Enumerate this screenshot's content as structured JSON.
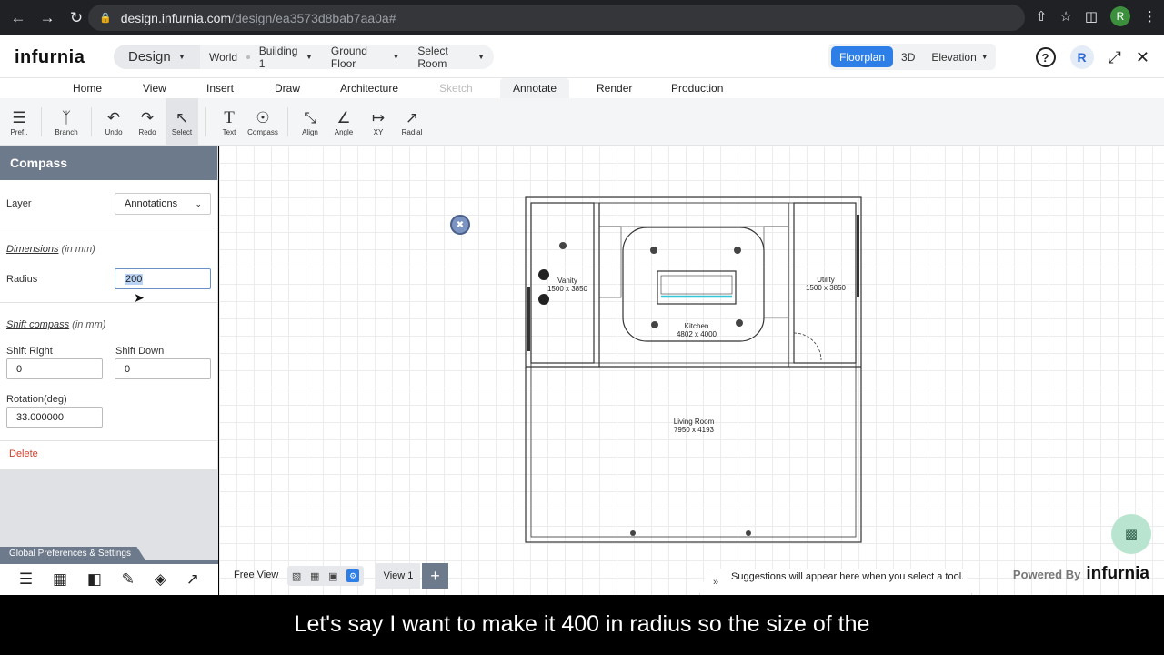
{
  "browser": {
    "url_host": "design.infurnia.com",
    "url_path": "/design/ea3573d8bab7aa0a#",
    "profile_initial": "R"
  },
  "header": {
    "logo": "infurnia",
    "breadcrumb": {
      "design": "Design",
      "world": "World",
      "building": "Building 1",
      "floor": "Ground Floor",
      "room": "Select Room"
    },
    "views": {
      "floorplan": "Floorplan",
      "three_d": "3D",
      "elevation": "Elevation"
    },
    "avatar_initial": "R"
  },
  "menu": {
    "tabs": [
      "Home",
      "View",
      "Insert",
      "Draw",
      "Architecture",
      "Sketch",
      "Annotate",
      "Render",
      "Production"
    ],
    "active": "Annotate",
    "disabled": "Sketch"
  },
  "toolbar": {
    "tools": [
      {
        "label": "Pref..",
        "icon": "sliders-icon"
      },
      {
        "label": "Branch",
        "icon": "branch-icon"
      },
      {
        "label": "Undo",
        "icon": "undo-icon"
      },
      {
        "label": "Redo",
        "icon": "redo-icon"
      },
      {
        "label": "Select",
        "icon": "pointer-icon"
      },
      {
        "label": "Text",
        "icon": "text-icon"
      },
      {
        "label": "Compass",
        "icon": "compass-icon"
      },
      {
        "label": "Align",
        "icon": "align-icon"
      },
      {
        "label": "Angle",
        "icon": "angle-icon"
      },
      {
        "label": "XY",
        "icon": "xy-dimension-icon"
      },
      {
        "label": "Radial",
        "icon": "radial-icon"
      }
    ]
  },
  "panel": {
    "title": "Compass",
    "layer_label": "Layer",
    "layer_value": "Annotations",
    "dimensions_label": "Dimensions",
    "dimensions_unit": "(in mm)",
    "radius_label": "Radius",
    "radius_value": "200",
    "shift_label": "Shift compass",
    "shift_unit": "(in mm)",
    "shift_right_label": "Shift Right",
    "shift_right_value": "0",
    "shift_down_label": "Shift Down",
    "shift_down_value": "0",
    "rotation_label": "Rotation(deg)",
    "rotation_value": "33.000000",
    "delete_label": "Delete",
    "global_prefs": "Global Preferences & Settings"
  },
  "rooms": [
    {
      "name": "Vanity",
      "size": "1500 x 3850"
    },
    {
      "name": "Kitchen",
      "size": "4802 x 4000"
    },
    {
      "name": "Utility",
      "size": "1500 x 3850"
    },
    {
      "name": "Living Room",
      "size": "7950 x 4193"
    }
  ],
  "bottom": {
    "free_view": "Free View",
    "view_tab": "View 1",
    "suggestions": "Suggestions will appear here when you select a tool.",
    "powered_by": "Powered By",
    "powered_logo": "infurnia"
  },
  "subtitle": "Let's say I want to make it 400 in radius so the size of the"
}
